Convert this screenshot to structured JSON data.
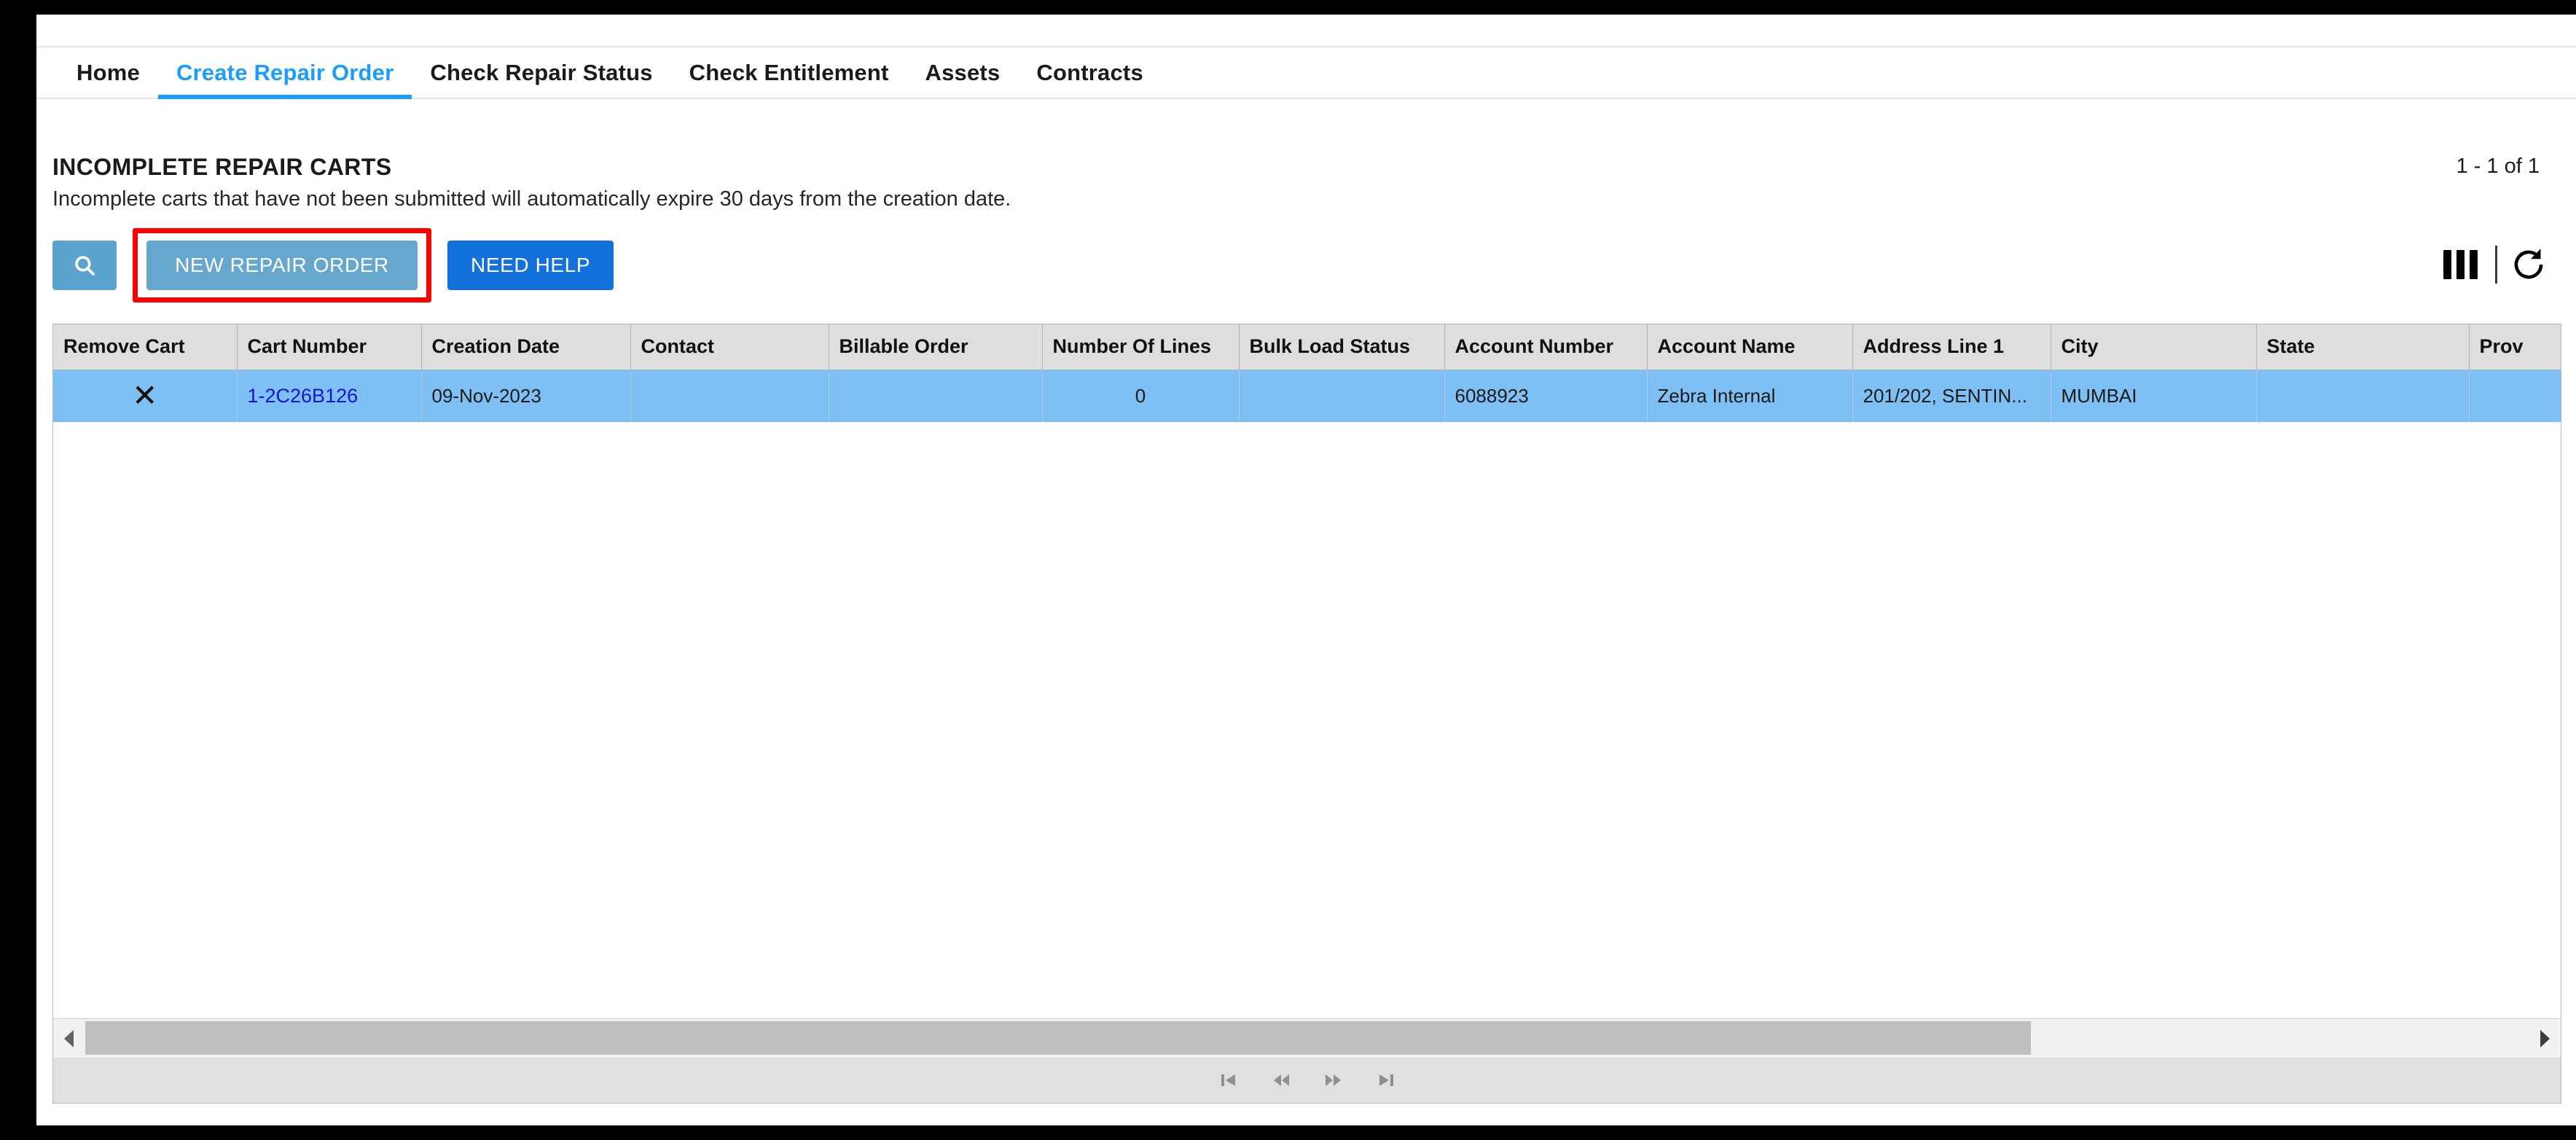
{
  "nav": {
    "tabs": [
      {
        "label": "Home",
        "active": false
      },
      {
        "label": "Create Repair Order",
        "active": true
      },
      {
        "label": "Check Repair Status",
        "active": false
      },
      {
        "label": "Check Entitlement",
        "active": false
      },
      {
        "label": "Assets",
        "active": false
      },
      {
        "label": "Contracts",
        "active": false
      }
    ]
  },
  "header": {
    "title": "INCOMPLETE REPAIR CARTS",
    "subtitle": "Incomplete carts that have not been submitted will automatically expire 30 days from the creation date.",
    "record_count": "1 - 1 of 1"
  },
  "toolbar": {
    "search_icon": "search-icon",
    "new_repair_order_label": "NEW REPAIR ORDER",
    "need_help_label": "NEED HELP",
    "columns_icon": "columns-icon",
    "refresh_icon": "refresh-icon",
    "highlight_color": "#ff0000",
    "new_repair_order_color": "#66a8cd",
    "need_help_color": "#1271db",
    "search_button_color": "#5ba3cf"
  },
  "grid": {
    "columns": [
      "Remove Cart",
      "Cart Number",
      "Creation Date",
      "Contact",
      "Billable Order",
      "Number Of Lines",
      "Bulk Load Status",
      "Account Number",
      "Account Name",
      "Address Line 1",
      "City",
      "State",
      "Prov"
    ],
    "rows": [
      {
        "remove_cart": "✕",
        "cart_number": "1-2C26B126",
        "creation_date": "09-Nov-2023",
        "contact": "",
        "billable_order": "",
        "number_of_lines": "0",
        "bulk_load_status": "",
        "account_number": "6088923",
        "account_name": "Zebra Internal",
        "address_line_1": "201/202, SENTIN...",
        "city": "MUMBAI",
        "state": "",
        "prov": ""
      }
    ],
    "selected_row_color": "#7ec0f4",
    "header_color": "#dededd"
  },
  "pager": {
    "first_label": "first-page",
    "previous_label": "previous-page",
    "next_label": "next-page",
    "last_label": "last-page"
  }
}
